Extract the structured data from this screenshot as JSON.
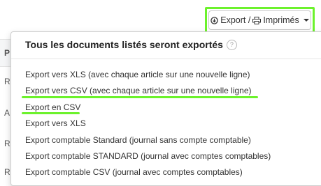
{
  "toolbar": {
    "export_label": "Export / ",
    "print_label": "Imprimés",
    "export_icon": "circle-arrow-icon",
    "print_icon": "printer-icon",
    "caret_icon": "caret-down-icon"
  },
  "dropdown": {
    "header": "Tous les documents listés seront exportés",
    "help_symbol": "?",
    "items": [
      {
        "label": "Export vers XLS (avec chaque article sur une nouvelle ligne)"
      },
      {
        "label": "Export vers CSV (avec chaque article sur une nouvelle ligne)"
      },
      {
        "label": "Export en CSV"
      },
      {
        "label": "Export vers XLS"
      },
      {
        "label": "Export comptable Standard (journal sans compte comptable)"
      },
      {
        "label": "Export comptable STANDARD (journal avec comptes comptables)"
      },
      {
        "label": "Export comptable CSV (journal avec comptes comptables)"
      }
    ]
  },
  "background": {
    "row_letters": [
      "R",
      "A",
      "R",
      "R"
    ],
    "header_letter": "P"
  },
  "colors": {
    "highlight": "#6cf22c"
  }
}
